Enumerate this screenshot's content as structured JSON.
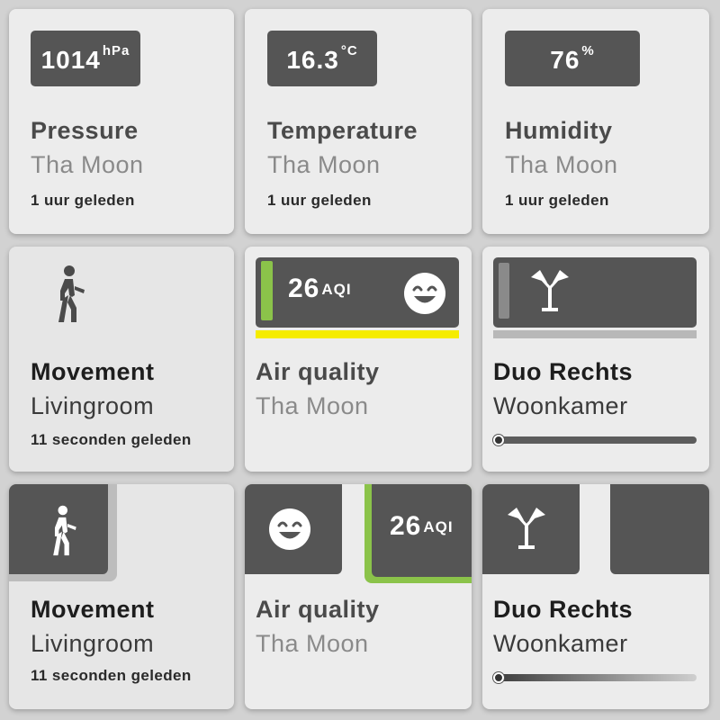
{
  "colors": {
    "background": "#d2d2d2",
    "tile": "#ececec",
    "badge": "#555555",
    "aqi_good": "#8bc34a",
    "aqi_line": "#f5ec00"
  },
  "pressure": {
    "value": "1014",
    "unit": "hPa",
    "title": "Pressure",
    "subtitle": "Tha Moon",
    "time": "1 uur geleden"
  },
  "temperature": {
    "value": "16.3",
    "unit": "°C",
    "title": "Temperature",
    "subtitle": "Tha Moon",
    "time": "1 uur geleden"
  },
  "humidity": {
    "value": "76",
    "unit": "%",
    "title": "Humidity",
    "subtitle": "Tha Moon",
    "time": "1 uur geleden"
  },
  "movement1": {
    "icon": "walking-person-icon",
    "title": "Movement",
    "subtitle": "Livingroom",
    "time": "11 seconden geleden"
  },
  "air1": {
    "value": "26",
    "unit": "AQI",
    "icon": "smiley-icon",
    "title": "Air quality",
    "subtitle": "Tha Moon",
    "level_fraction": 0.05
  },
  "duo1": {
    "icon": "lamp-icon",
    "title": "Duo Rechts",
    "subtitle": "Woonkamer",
    "level_fraction": 0.02
  },
  "movement2": {
    "icon": "walking-person-icon",
    "title": "Movement",
    "subtitle": "Livingroom",
    "time": "11 seconden geleden"
  },
  "air2": {
    "value": "26",
    "unit": "AQI",
    "icon": "smiley-icon",
    "title": "Air quality",
    "subtitle": "Tha Moon"
  },
  "duo2": {
    "icon": "lamp-icon",
    "title": "Duo Rechts",
    "subtitle": "Woonkamer",
    "level_fraction": 0.02
  }
}
